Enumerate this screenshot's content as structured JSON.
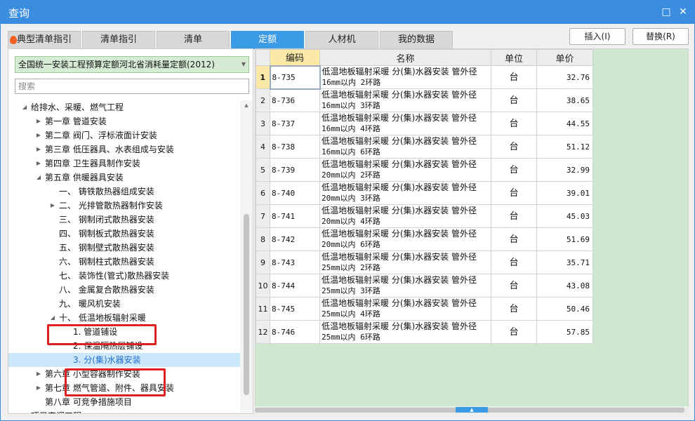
{
  "window": {
    "title": "查询",
    "icons": [
      "maximize-icon",
      "close-icon"
    ]
  },
  "tabs": [
    {
      "label": "典型清单指引",
      "active": false,
      "icon": "flame-icon"
    },
    {
      "label": "清单指引",
      "active": false
    },
    {
      "label": "清单",
      "active": false
    },
    {
      "label": "定额",
      "active": true
    },
    {
      "label": "人材机",
      "active": false
    },
    {
      "label": "我的数据",
      "active": false
    }
  ],
  "actions": {
    "insert": "插入(I)",
    "replace": "替换(R)"
  },
  "left": {
    "dropdown_value": "全国统一安装工程预算定额河北省消耗量定额(2012)",
    "search_placeholder": "搜索",
    "tree": [
      {
        "label": "给排水、采暖、燃气工程",
        "toggle": "expanded"
      },
      {
        "label": "第一章 管道安装",
        "toggle": "collapsed"
      },
      {
        "label": "第二章 阀门、浮标液面计安装",
        "toggle": "collapsed"
      },
      {
        "label": "第三章 低压器具、水表组成与安装",
        "toggle": "collapsed"
      },
      {
        "label": "第四章 卫生器具制作安装",
        "toggle": "collapsed"
      },
      {
        "label": "第五章 供暖器具安装",
        "toggle": "expanded"
      },
      {
        "label": "一、 铸铁散热器组成安装",
        "toggle": "none"
      },
      {
        "label": "二、 光排管散热器制作安装",
        "toggle": "collapsed"
      },
      {
        "label": "三、 钢制闭式散热器安装",
        "toggle": "none"
      },
      {
        "label": "四、 钢制板式散热器安装",
        "toggle": "none"
      },
      {
        "label": "五、 钢制壁式散热器安装",
        "toggle": "none"
      },
      {
        "label": "六、 钢制柱式散热器安装",
        "toggle": "none"
      },
      {
        "label": "七、 装饰性(管式)散热器安装",
        "toggle": "none"
      },
      {
        "label": "八、 金属复合散热器安装",
        "toggle": "none"
      },
      {
        "label": "九、 暖风机安装",
        "toggle": "none"
      },
      {
        "label": "十、 低温地板辐射采暖",
        "toggle": "expanded"
      },
      {
        "label": "1. 管道铺设",
        "toggle": "none"
      },
      {
        "label": "2. 保温隔热层铺设",
        "toggle": "none"
      },
      {
        "label": "3. 分(集)水器安装",
        "toggle": "none",
        "selected": true
      },
      {
        "label": "第六章 小型容器制作安装",
        "toggle": "collapsed"
      },
      {
        "label": "第七章 燃气管道、附件、器具安装",
        "toggle": "collapsed"
      },
      {
        "label": "第八章 可竞争措施项目",
        "toggle": "none"
      },
      {
        "label": "项目安调工程",
        "toggle": "none"
      }
    ]
  },
  "grid": {
    "headers": {
      "code": "编码",
      "name": "名称",
      "unit": "单位",
      "price": "单价"
    },
    "rows": [
      {
        "num": "1",
        "code": "8-735",
        "name1": "低温地板辐射采暖 分(集)水器安装 管外径",
        "name2": "16mm以内 2环路",
        "unit": "台",
        "price": "32.76"
      },
      {
        "num": "2",
        "code": "8-736",
        "name1": "低温地板辐射采暖 分(集)水器安装 管外径",
        "name2": "16mm以内 3环路",
        "unit": "台",
        "price": "38.65"
      },
      {
        "num": "3",
        "code": "8-737",
        "name1": "低温地板辐射采暖 分(集)水器安装 管外径",
        "name2": "16mm以内 4环路",
        "unit": "台",
        "price": "44.55"
      },
      {
        "num": "4",
        "code": "8-738",
        "name1": "低温地板辐射采暖 分(集)水器安装 管外径",
        "name2": "16mm以内 6环路",
        "unit": "台",
        "price": "51.12"
      },
      {
        "num": "5",
        "code": "8-739",
        "name1": "低温地板辐射采暖 分(集)水器安装 管外径",
        "name2": "20mm以内 2环路",
        "unit": "台",
        "price": "32.99"
      },
      {
        "num": "6",
        "code": "8-740",
        "name1": "低温地板辐射采暖 分(集)水器安装 管外径",
        "name2": "20mm以内 3环路",
        "unit": "台",
        "price": "39.01"
      },
      {
        "num": "7",
        "code": "8-741",
        "name1": "低温地板辐射采暖 分(集)水器安装 管外径",
        "name2": "20mm以内 4环路",
        "unit": "台",
        "price": "45.03"
      },
      {
        "num": "8",
        "code": "8-742",
        "name1": "低温地板辐射采暖 分(集)水器安装 管外径",
        "name2": "20mm以内 6环路",
        "unit": "台",
        "price": "51.69"
      },
      {
        "num": "9",
        "code": "8-743",
        "name1": "低温地板辐射采暖 分(集)水器安装 管外径",
        "name2": "25mm以内 2环路",
        "unit": "台",
        "price": "35.71"
      },
      {
        "num": "10",
        "code": "8-744",
        "name1": "低温地板辐射采暖 分(集)水器安装 管外径",
        "name2": "25mm以内 3环路",
        "unit": "台",
        "price": "43.08"
      },
      {
        "num": "11",
        "code": "8-745",
        "name1": "低温地板辐射采暖 分(集)水器安装 管外径",
        "name2": "25mm以内 4环路",
        "unit": "台",
        "price": "50.46"
      },
      {
        "num": "12",
        "code": "8-746",
        "name1": "低温地板辐射采暖 分(集)水器安装 管外径",
        "name2": "25mm以内 6环路",
        "unit": "台",
        "price": "57.85"
      }
    ]
  },
  "colors": {
    "titlebar": "#3b8de0",
    "active_tab": "#3b9be4",
    "selection": "#cce6fa",
    "annotation": "#e02020",
    "grid_empty": "#cfe6cf"
  }
}
